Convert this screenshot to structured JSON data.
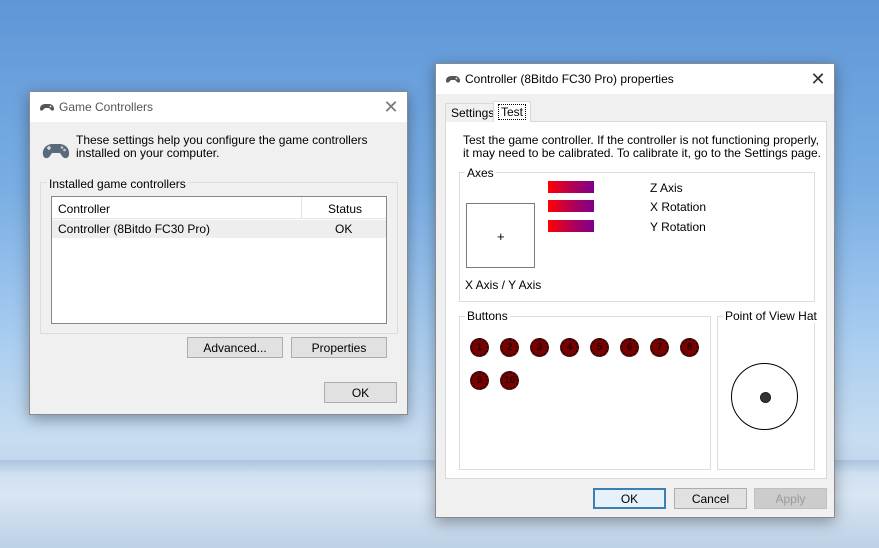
{
  "desktop": {
    "colors": {
      "sky": "#7aaee4"
    }
  },
  "game_controllers": {
    "title": "Game Controllers",
    "description": "These settings help you configure the game controllers installed on your computer.",
    "group_label": "Installed game controllers",
    "columns": [
      "Controller",
      "Status"
    ],
    "rows": [
      {
        "controller": "Controller (8Bitdo FC30 Pro)",
        "status": "OK"
      }
    ],
    "advanced_label": "Advanced...",
    "properties_label": "Properties",
    "ok_label": "OK"
  },
  "properties": {
    "title": "Controller (8Bitdo FC30 Pro) properties",
    "tabs": [
      "Settings",
      "Test"
    ],
    "active_tab": "Test",
    "instructions": "Test the game controller.  If the controller is not functioning properly, it may need to be calibrated.  To calibrate it, go to the Settings page.",
    "axes_label": "Axes",
    "xy_axis_label": "X Axis / Y Axis",
    "xy_marker": "+",
    "axis_bars": [
      "Z Axis",
      "X Rotation",
      "Y Rotation"
    ],
    "buttons_label": "Buttons",
    "buttons": [
      "1",
      "2",
      "3",
      "4",
      "5",
      "6",
      "7",
      "8",
      "9",
      "10"
    ],
    "pov_label": "Point of View Hat",
    "ok_label": "OK",
    "cancel_label": "Cancel",
    "apply_label": "Apply"
  }
}
